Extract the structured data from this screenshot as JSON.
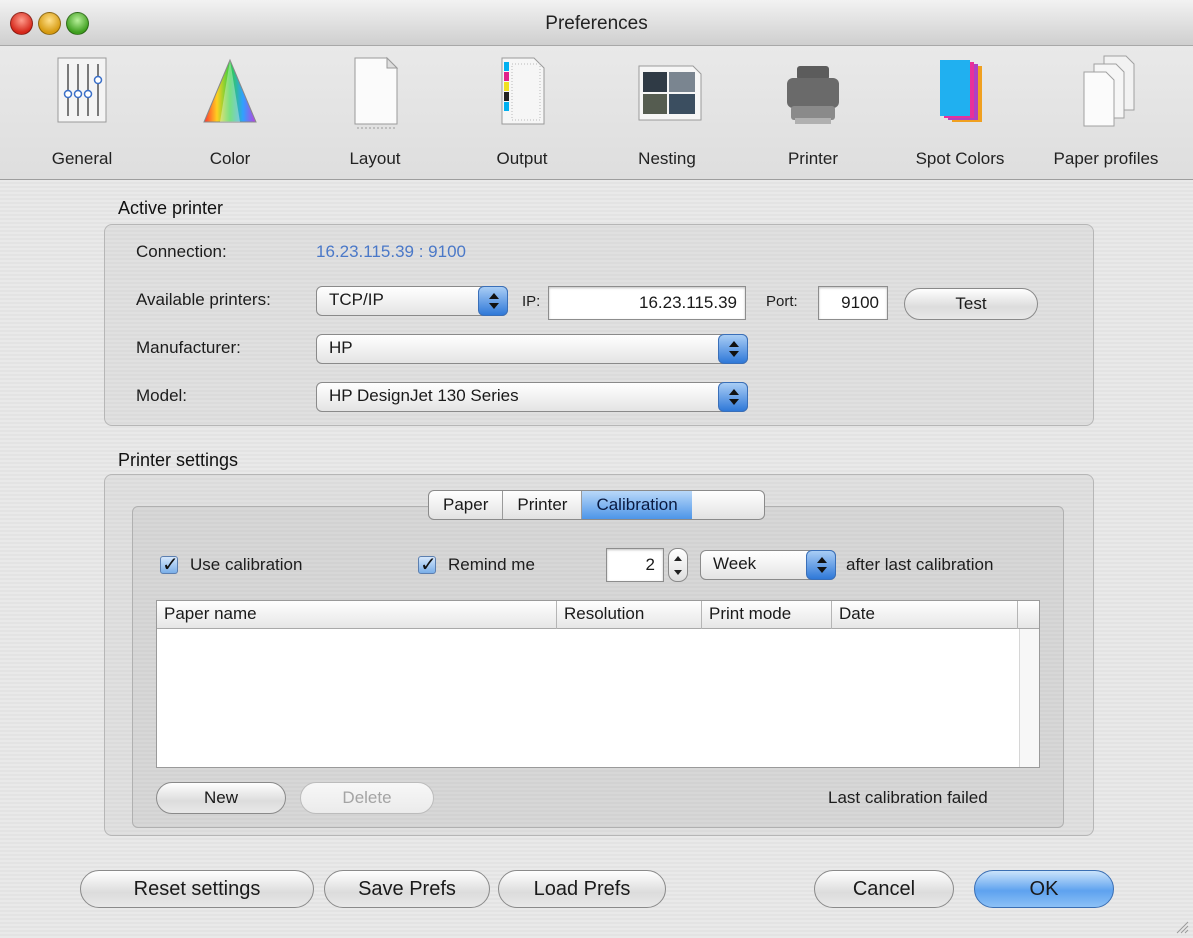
{
  "window": {
    "title": "Preferences"
  },
  "toolbar": {
    "items": [
      {
        "label": "General",
        "icon": "sliders-icon"
      },
      {
        "label": "Color",
        "icon": "color-prism-icon"
      },
      {
        "label": "Layout",
        "icon": "page-layout-icon"
      },
      {
        "label": "Output",
        "icon": "output-page-icon"
      },
      {
        "label": "Nesting",
        "icon": "nesting-photos-icon"
      },
      {
        "label": "Printer",
        "icon": "printer-icon"
      },
      {
        "label": "Spot Colors",
        "icon": "spot-colors-icon"
      },
      {
        "label": "Paper profiles",
        "icon": "paper-profiles-icon"
      }
    ]
  },
  "active_printer": {
    "heading": "Active printer",
    "connection_label": "Connection:",
    "connection_value": "16.23.115.39 : 9100",
    "available_label": "Available printers:",
    "available_value": "TCP/IP",
    "ip_label": "IP:",
    "ip_value": "16.23.115.39",
    "port_label": "Port:",
    "port_value": "9100",
    "test_label": "Test",
    "manufacturer_label": "Manufacturer:",
    "manufacturer_value": "HP",
    "model_label": "Model:",
    "model_value": "HP DesignJet 130 Series"
  },
  "printer_settings": {
    "heading": "Printer settings",
    "tabs": [
      "Paper",
      "Printer",
      "Calibration"
    ],
    "active_tab": "Calibration",
    "use_calibration_label": "Use calibration",
    "use_calibration_checked": true,
    "remind_me_label": "Remind me",
    "remind_me_checked": true,
    "remind_count": "2",
    "remind_period": "Week",
    "after_label": "after last calibration",
    "table_columns": [
      "Paper name",
      "Resolution",
      "Print mode",
      "Date"
    ],
    "table_rows": [],
    "new_label": "New",
    "delete_label": "Delete",
    "status": "Last calibration failed"
  },
  "footer": {
    "reset_label": "Reset settings",
    "save_label": "Save Prefs",
    "load_label": "Load Prefs",
    "cancel_label": "Cancel",
    "ok_label": "OK"
  },
  "colors": {
    "accent": "#4d95e8",
    "link": "#4a78c8"
  }
}
